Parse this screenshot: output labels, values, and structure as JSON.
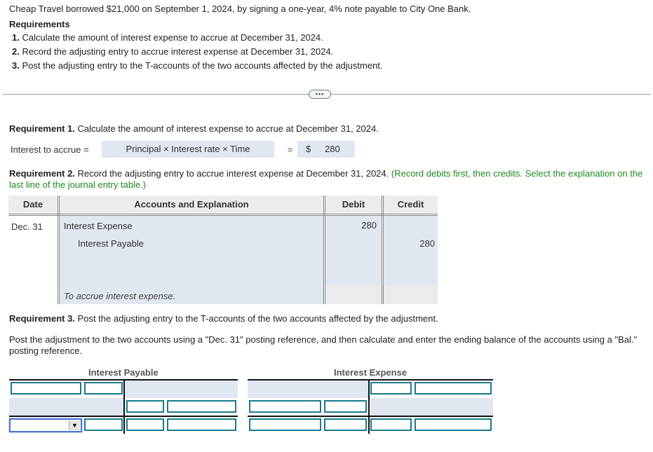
{
  "problem": {
    "statement": "Cheap Travel borrowed $21,000 on September 1, 2024, by signing a one-year, 4% note payable to City One Bank.",
    "requirements_heading": "Requirements",
    "requirements": [
      {
        "num": "1.",
        "text": "Calculate the amount of interest expense to accrue at December 31, 2024."
      },
      {
        "num": "2.",
        "text": "Record the adjusting entry to accrue interest expense at December 31, 2024."
      },
      {
        "num": "3.",
        "text": "Post the adjusting entry to the T-accounts of the two accounts affected by the adjustment."
      }
    ]
  },
  "divider": {
    "more_button_label": "•••"
  },
  "req1": {
    "label": "Requirement 1.",
    "text": "Calculate the amount of interest expense to accrue at December 31, 2024.",
    "interest_label": "Interest to accrue =",
    "formula": "Principal × Interest rate × Time",
    "equals": "=",
    "currency": "$",
    "result": "280"
  },
  "req2": {
    "label": "Requirement 2.",
    "text": "Record the adjusting entry to accrue interest expense at December 31, 2024.",
    "instruction": "(Record debits first, then credits. Select the explanation on the last line of the journal entry table.)",
    "table": {
      "headers": {
        "date": "Date",
        "accounts": "Accounts and Explanation",
        "debit": "Debit",
        "credit": "Credit"
      },
      "date": "Dec. 31",
      "rows": [
        {
          "account": "Interest Expense",
          "debit": "280",
          "credit": ""
        },
        {
          "account": "Interest Payable",
          "debit": "",
          "credit": "280"
        }
      ],
      "explanation": "To accrue interest expense."
    }
  },
  "req3": {
    "label": "Requirement 3.",
    "text": "Post the adjusting entry to the T-accounts of the two accounts affected by the adjustment.",
    "instruction": "Post the adjustment to the two accounts using a \"Dec. 31\" posting reference, and then calculate and enter the ending balance of the accounts using a \"Bal.\" posting reference.",
    "t_accounts": [
      {
        "title": "Interest Payable",
        "bal_select_value": ""
      },
      {
        "title": "Interest Expense"
      }
    ]
  },
  "colors": {
    "accent_green": "#228822",
    "input_border": "#1b7a8c",
    "shade": "#e1e7f0"
  }
}
